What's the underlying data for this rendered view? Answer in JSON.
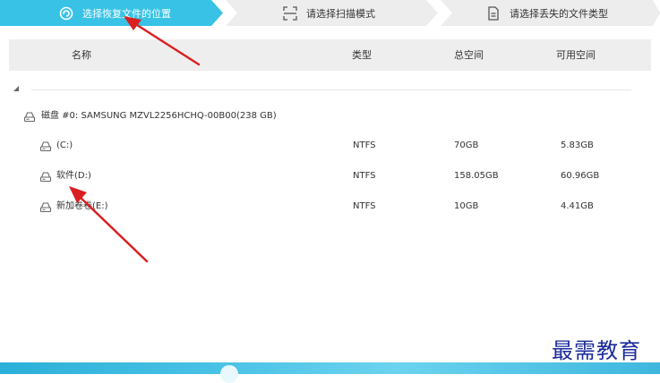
{
  "steps": [
    {
      "label": "选择恢复文件的位置",
      "icon": "refresh-icon",
      "active": true
    },
    {
      "label": "请选择扫描模式",
      "icon": "scan-icon",
      "active": false
    },
    {
      "label": "请选择丢失的文件类型",
      "icon": "document-icon",
      "active": false
    }
  ],
  "table": {
    "headers": {
      "name": "名称",
      "type": "类型",
      "total": "总空间",
      "free": "可用空间"
    }
  },
  "tree": {
    "disk": {
      "label": "磁盘 #0: SAMSUNG MZVL2256HCHQ-00B00(238 GB)",
      "icon": "drive-icon"
    },
    "volumes": [
      {
        "label": "(C:)",
        "type": "NTFS",
        "total": "70GB",
        "free": "5.83GB"
      },
      {
        "label": "软件(D:)",
        "type": "NTFS",
        "total": "158.05GB",
        "free": "60.96GB"
      },
      {
        "label": "新加卷卷(E:)",
        "type": "NTFS",
        "total": "10GB",
        "free": "4.41GB"
      }
    ]
  },
  "watermark": "最需教育",
  "colors": {
    "active_step": "#38c3e6",
    "inactive_step": "#ededed",
    "header_bg": "#eeeeee",
    "arrow": "#d92020",
    "watermark": "#1a2a9a"
  }
}
